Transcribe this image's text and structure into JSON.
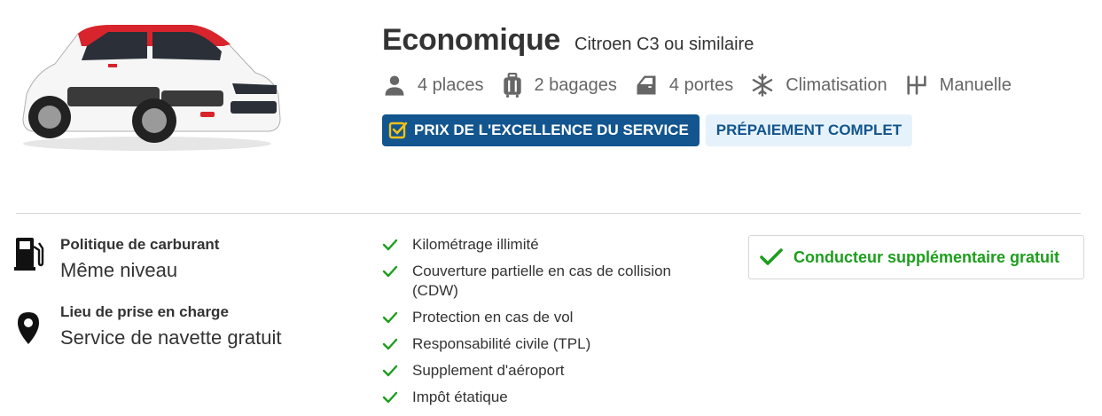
{
  "car": {
    "category": "Economique",
    "model": "Citroen C3 ou similaire"
  },
  "specs": [
    {
      "icon": "person-icon",
      "label": "4 places"
    },
    {
      "icon": "luggage-icon",
      "label": "2 bagages"
    },
    {
      "icon": "door-icon",
      "label": "4 portes"
    },
    {
      "icon": "snowflake-icon",
      "label": "Climatisation"
    },
    {
      "icon": "gearshift-icon",
      "label": "Manuelle"
    }
  ],
  "badges": {
    "award": "PRIX DE L'EXCELLENCE DU SERVICE",
    "prepay": "PRÉPAIEMENT COMPLET"
  },
  "info": {
    "fuel": {
      "label": "Politique de carburant",
      "value": "Même niveau"
    },
    "pickup": {
      "label": "Lieu de prise en charge",
      "value": "Service de navette gratuit"
    }
  },
  "features": [
    "Kilométrage illimité",
    "Couverture partielle en cas de collision (CDW)",
    "Protection en cas de vol",
    "Responsabilité civile (TPL)",
    "Supplement d'aéroport",
    "Impôt étatique"
  ],
  "extra": {
    "driver": "Conducteur supplémentaire gratuit"
  },
  "colors": {
    "brand_blue": "#13558e",
    "light_blue": "#e6f2fb",
    "check_green": "#1c9e1c"
  }
}
